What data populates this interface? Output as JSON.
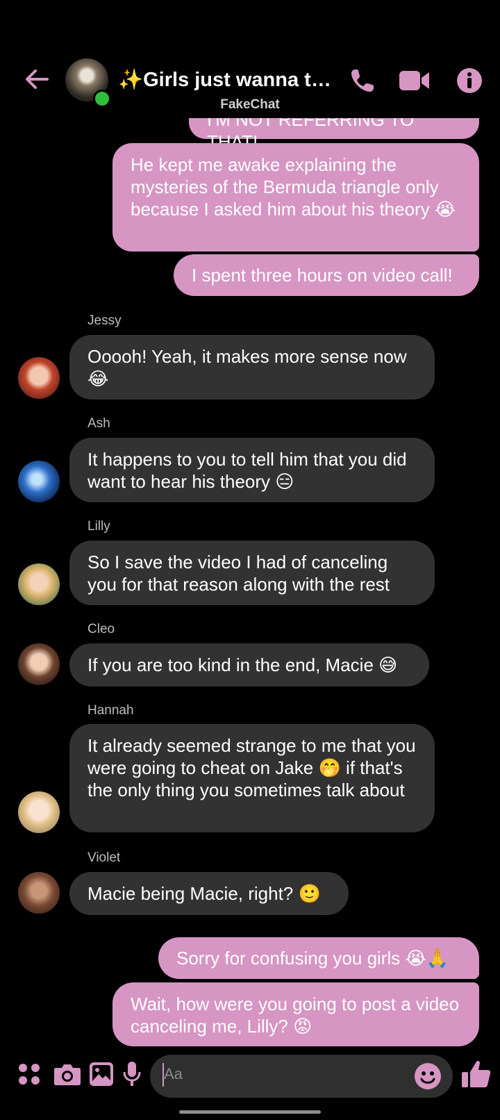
{
  "header": {
    "title": "✨Girls just wanna to h...",
    "subtitle": "FakeChat",
    "accent": "#d695c3"
  },
  "messages": [
    {
      "type": "out",
      "text": "I'M NOT REFERRING TO THAT!"
    },
    {
      "type": "out",
      "text": "He kept me awake explaining the mysteries of the Bermuda triangle only because I asked him about his theory 😭"
    },
    {
      "type": "out",
      "text": "I spent three hours on video call!"
    },
    {
      "type": "in",
      "sender": "Jessy",
      "text": "Ooooh! Yeah, it makes more sense now 😂"
    },
    {
      "type": "in",
      "sender": "Ash",
      "text": "It happens to you to tell him that you did want to hear his theory 😑"
    },
    {
      "type": "in",
      "sender": "Lilly",
      "text": "So I save the video I had of canceling you for that reason along with the rest"
    },
    {
      "type": "in",
      "sender": "Cleo",
      "text": "If you are too kind in the end, Macie 😅"
    },
    {
      "type": "in",
      "sender": "Hannah",
      "text": "It already seemed strange to me that you were going to cheat on Jake 🤭 if that's the only thing you sometimes talk about"
    },
    {
      "type": "in",
      "sender": "Violet",
      "text": "Macie being Macie, right? 🙂"
    },
    {
      "type": "out",
      "text": "Sorry for confusing you girls 😭🙏"
    },
    {
      "type": "out",
      "text": "Wait, how were you going to post a video canceling me, Lilly? 😡"
    }
  ],
  "composer": {
    "placeholder": "Aa"
  },
  "icons": [
    "back-arrow-icon",
    "phone-icon",
    "video-camera-icon",
    "info-icon",
    "apps-grid-icon",
    "camera-icon",
    "gallery-icon",
    "microphone-icon",
    "emoji-icon",
    "thumbs-up-icon"
  ]
}
